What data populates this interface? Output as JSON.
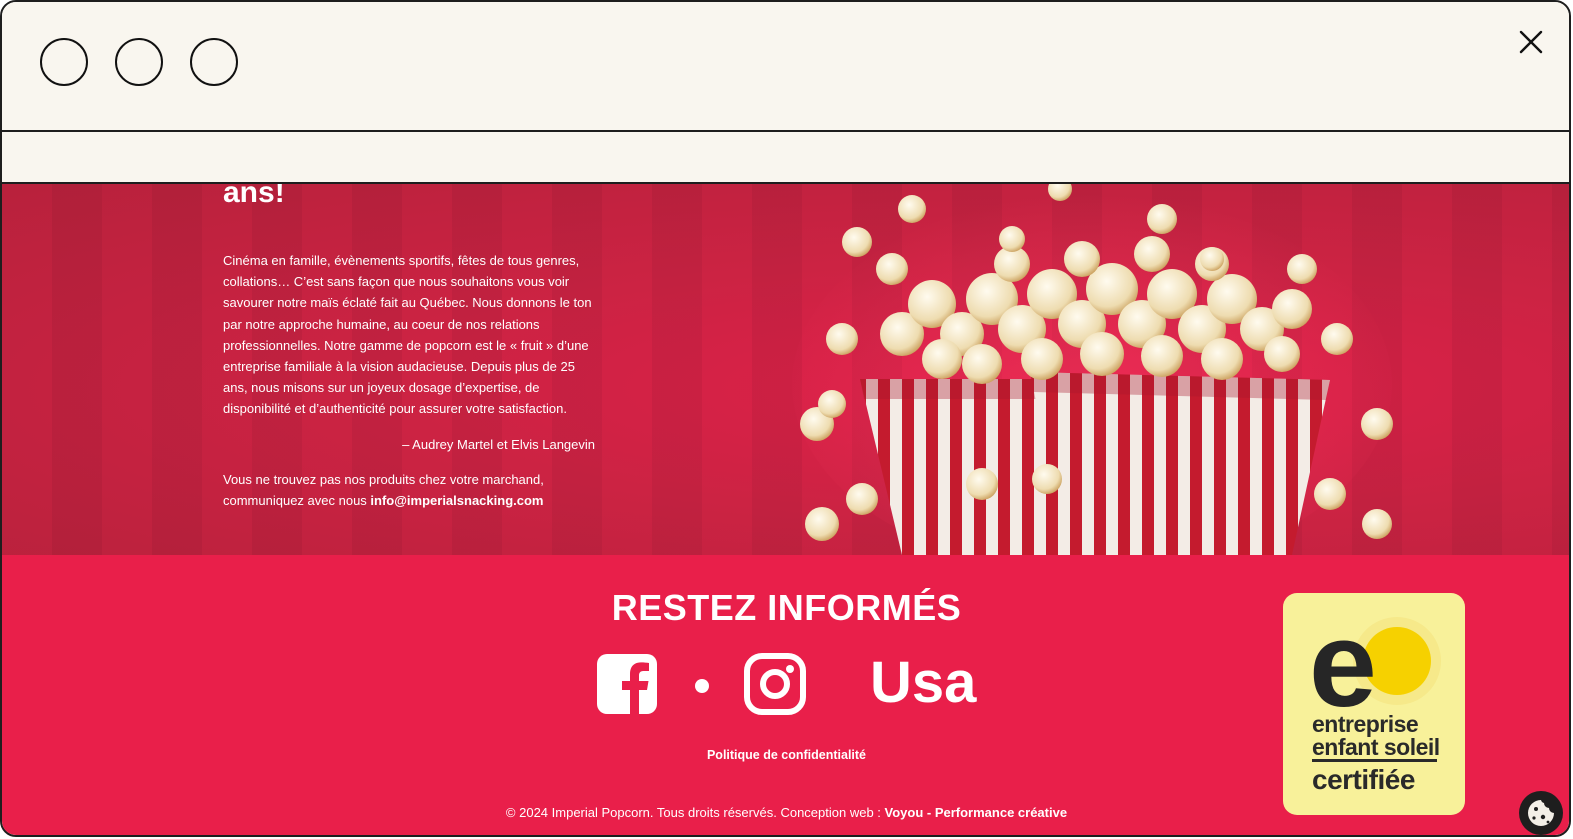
{
  "hero": {
    "heading_fragment": "ans!",
    "paragraph": "Cinéma en famille, évènements sportifs, fêtes de tous genres, collations… C’est sans façon que nous souhaitons vous voir savourer notre maïs éclaté fait au Québec. Nous donnons le ton par notre approche humaine, au coeur de nos relations professionnelles. Notre gamme de popcorn est le « fruit » d’une entreprise familiale à la vision audacieuse. Depuis plus de 25 ans, nous misons sur un joyeux dosage d’expertise, de disponibilité et d’authenticité pour assurer votre satisfaction.",
    "signature": "– Audrey Martel et Elvis Langevin",
    "contact_text": "Vous ne trouvez pas nos produits chez votre marchand, communiquez avec nous ",
    "contact_email": "info@imperialsnacking.com"
  },
  "footer": {
    "title": "RESTEZ INFORMÉS",
    "social": [
      {
        "name": "facebook",
        "icon": "facebook-icon"
      },
      {
        "name": "instagram",
        "icon": "instagram-icon"
      }
    ],
    "usa_label": "Usa",
    "privacy_label": "Politique de confidentialité",
    "copyright_text": "© 2024 Imperial Popcorn. Tous droits réservés. Conception web : ",
    "agency_label": "Voyou - Performance créative",
    "badge": {
      "line1": "entreprise",
      "line2": "enfant soleil",
      "line3": "certifiée",
      "logo_letter": "e"
    }
  },
  "colors": {
    "footer_bg": "#e91f4a",
    "hero_bg": "#c4223f",
    "badge_bg": "#f8f19a",
    "badge_sun": "#f6d100",
    "window_chrome": "#f9f6ef"
  },
  "icons": {
    "window_controls": [
      "circle-icon",
      "circle-icon",
      "circle-icon"
    ],
    "close": "close-icon",
    "cookie": "cookie-icon"
  }
}
